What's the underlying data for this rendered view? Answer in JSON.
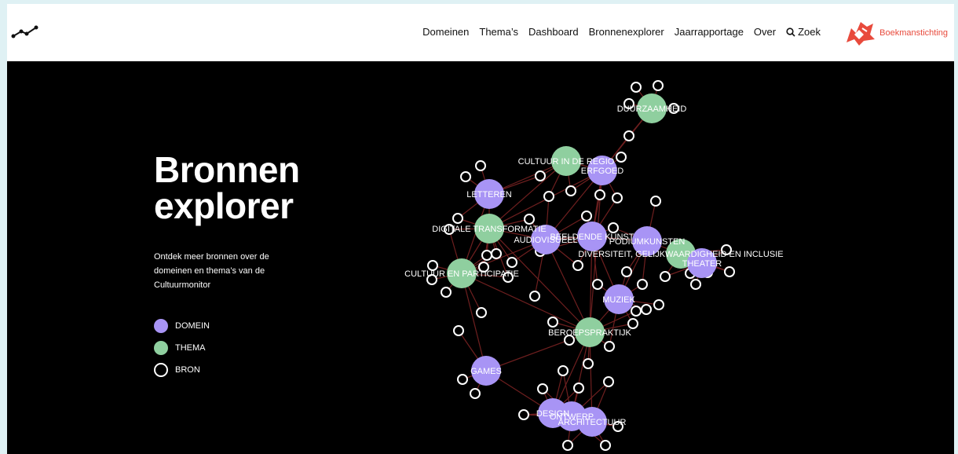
{
  "nav": {
    "items": [
      "Domeinen",
      "Thema’s",
      "Dashboard",
      "Bronnenexplorer",
      "Jaarrapportage",
      "Over"
    ],
    "search_label": "Zoek"
  },
  "brand": {
    "name": "Boekmanstichting"
  },
  "hero": {
    "line1": "Bronnen",
    "line2": "explorer"
  },
  "intro": "Ontdek meer bronnen over de domeinen en thema’s van de Cultuurmonitor",
  "legend": [
    {
      "label": "DOMEIN",
      "color": "#a894f5"
    },
    {
      "label": "THEMA",
      "color": "#8fcf9f"
    },
    {
      "label": "BRON",
      "color": "none"
    }
  ],
  "colors": {
    "domein": "#a894f5",
    "thema": "#8fcf9f",
    "link": "#6e1f1f"
  },
  "graph_nodes": [
    {
      "label": "DUURZAAMHEID",
      "type": "thema"
    },
    {
      "label": "CULTUUR IN DE REGIO",
      "type": "thema"
    },
    {
      "label": "ERFGOED",
      "type": "domein"
    },
    {
      "label": "LETTEREN",
      "type": "domein"
    },
    {
      "label": "DIGITALE TRANSFORMATIE",
      "type": "thema"
    },
    {
      "label": "AUDIOVISUEEL",
      "type": "domein"
    },
    {
      "label": "BEELDENDE KUNST",
      "type": "domein"
    },
    {
      "label": "PODIUMKUNSTEN",
      "type": "domein"
    },
    {
      "label": "DIVERSITEIT, GELIJKWAARDIGHEID EN INCLUSIE",
      "type": "thema"
    },
    {
      "label": "THEATER",
      "type": "domein"
    },
    {
      "label": "CULTUUR EN PARTICIPATIE",
      "type": "thema"
    },
    {
      "label": "MUZIEK",
      "type": "domein"
    },
    {
      "label": "BEROEPSPRAKTIJK",
      "type": "thema"
    },
    {
      "label": "GAMES",
      "type": "domein"
    },
    {
      "label": "DESIGN",
      "type": "domein"
    },
    {
      "label": "ONTWERP",
      "type": "domein"
    },
    {
      "label": "ARCHITECTUUR",
      "type": "domein"
    }
  ]
}
